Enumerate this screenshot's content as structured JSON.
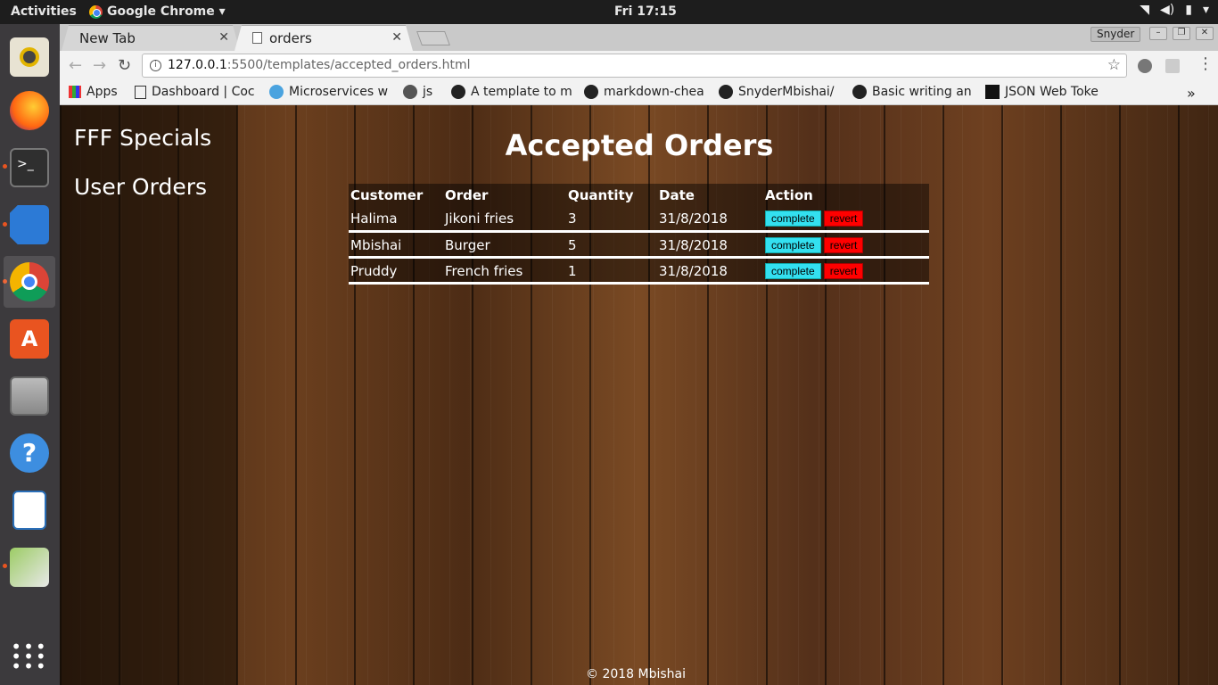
{
  "topbar": {
    "activities": "Activities",
    "app": "Google Chrome ▾",
    "clock": "Fri 17:15"
  },
  "browser": {
    "tabs": [
      {
        "label": "New Tab"
      },
      {
        "label": "orders"
      }
    ],
    "user": "Snyder",
    "url_host": "127.0.0.1",
    "url_rest": ":5500/templates/accepted_orders.html",
    "bookmarks": [
      "Apps",
      "Dashboard | Coc",
      "Microservices w",
      "js",
      "A template to m",
      "markdown-chea",
      "SnyderMbishai/",
      "Basic writing an",
      "JSON Web Toke"
    ],
    "overflow": "»"
  },
  "sidebar": {
    "links": [
      "FFF Specials",
      "User Orders"
    ]
  },
  "main": {
    "title": "Accepted Orders",
    "columns": [
      "Customer",
      "Order",
      "Quantity",
      "Date",
      "Action"
    ],
    "rows": [
      {
        "customer": "Halima",
        "order": "Jikoni fries",
        "quantity": "3",
        "date": "31/8/2018"
      },
      {
        "customer": "Mbishai",
        "order": "Burger",
        "quantity": "5",
        "date": "31/8/2018"
      },
      {
        "customer": "Pruddy",
        "order": "French fries",
        "quantity": "1",
        "date": "31/8/2018"
      }
    ],
    "complete_label": "complete",
    "revert_label": "revert"
  },
  "footer": "© 2018 Mbishai",
  "colors": {
    "complete": "#33e0f0",
    "revert": "#ff0000",
    "dock": "#3c3a3d",
    "accent": "#e95420"
  }
}
